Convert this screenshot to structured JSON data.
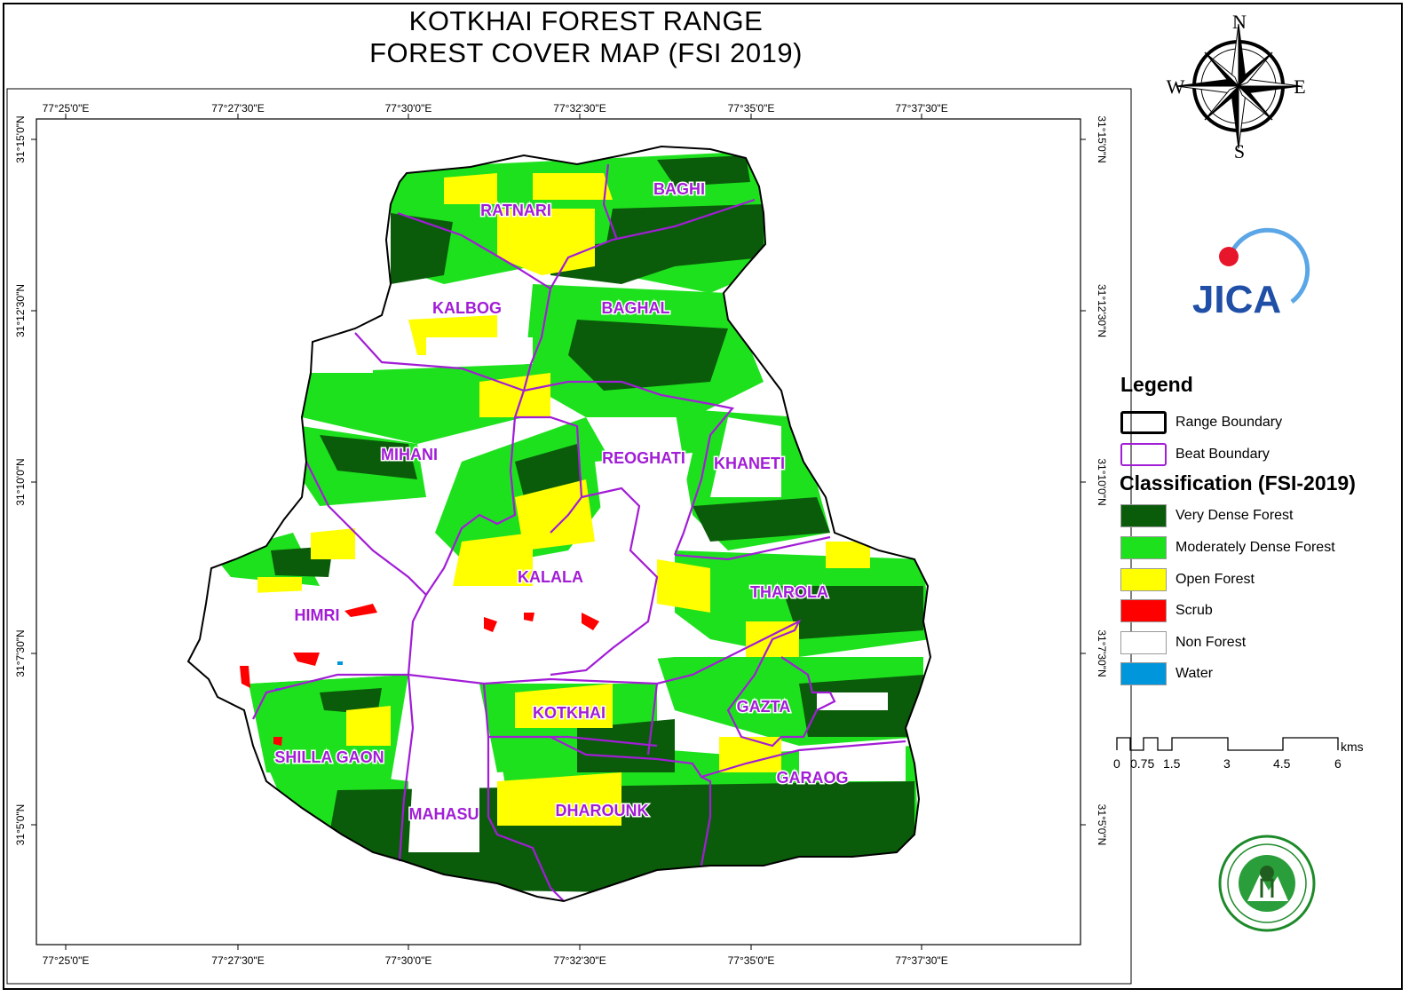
{
  "title": {
    "line1": "KOTKHAI FOREST RANGE",
    "line2": "FOREST COVER MAP (FSI 2019)"
  },
  "compass": {
    "north": "N",
    "south": "S",
    "east": "E",
    "west": "W"
  },
  "logos": {
    "top": "JICA",
    "bottom": "forest-department-emblem"
  },
  "coordinates": {
    "longitudes": [
      "77°25'0\"E",
      "77°27'30\"E",
      "77°30'0\"E",
      "77°32'30\"E",
      "77°35'0\"E",
      "77°37'30\"E"
    ],
    "latitudes": [
      "31°15'0\"N",
      "31°12'30\"N",
      "31°10'0\"N",
      "31°7'30\"N",
      "31°5'0\"N"
    ]
  },
  "beats": [
    "BAGHI",
    "RATNARI",
    "KALBOG",
    "BAGHAL",
    "MIHANI",
    "REOGHATI",
    "KHANETI",
    "KALALA",
    "THAROLA",
    "HIMRI",
    "GAZTA",
    "KOTKHAI",
    "SHILLA GAON",
    "GARAOG",
    "MAHASU",
    "DHAROUNK"
  ],
  "legend": {
    "title": "Legend",
    "boundaries": [
      {
        "label": "Range Boundary",
        "color": "#000000"
      },
      {
        "label": "Beat Boundary",
        "color": "#a21dd6"
      }
    ],
    "classification_title": "Classification (FSI-2019)",
    "classes": [
      {
        "label": "Very Dense Forest",
        "color": "#0a5c0a"
      },
      {
        "label": "Moderately Dense Forest",
        "color": "#1ee11e"
      },
      {
        "label": "Open Forest",
        "color": "#ffff00"
      },
      {
        "label": "Scrub",
        "color": "#ff0000"
      },
      {
        "label": "Non Forest",
        "color": "#ffffff"
      },
      {
        "label": "Water",
        "color": "#0096dc"
      }
    ]
  },
  "scale_bar": {
    "unit": "kms",
    "ticks": [
      "0",
      "0.75",
      "1.5",
      "3",
      "4.5",
      "6"
    ]
  }
}
